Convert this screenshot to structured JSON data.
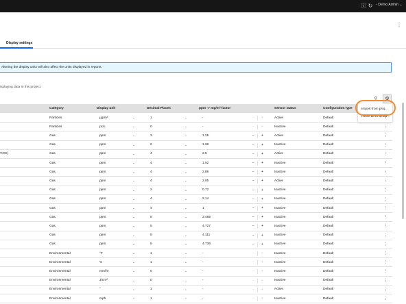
{
  "header": {
    "user_label": "Demo Admin",
    "icons": [
      "info-icon",
      "refresh-icon",
      "user-icon",
      "chevron-down-icon"
    ]
  },
  "tabs": [
    {
      "label": "Display settings",
      "selected": true
    }
  ],
  "info_banner": {
    "text": "Altering the display units will also affect the units displayed in reports."
  },
  "description": "isplaying data in this project.",
  "toolbar_icons": [
    "filter-icon",
    "gear-icon"
  ],
  "menu": {
    "items": [
      "Import from proj...",
      "Reset all to defau..."
    ]
  },
  "accent": "#0f62fe",
  "highlight_color": "#f08b2f",
  "table": {
    "columns": [
      "Category",
      "Display unit",
      "Decimal Places",
      "ppm -> mg/m³ factor",
      "Sensor status",
      "Configuration type"
    ],
    "rows": [
      {
        "name": "",
        "category": "Particles",
        "unit": "µg/m³",
        "places": "1",
        "factor": "-",
        "status": "Active",
        "config": "Default",
        "minus_enabled": false
      },
      {
        "name": "",
        "category": "Particles",
        "unit": "pc/L",
        "places": "0",
        "factor": "-",
        "status": "Inactive",
        "config": "Default",
        "minus_enabled": false
      },
      {
        "name": "",
        "category": "Gas",
        "unit": "ppm",
        "places": "3",
        "factor": "1.25",
        "status": "Active",
        "config": "Default",
        "minus_enabled": true
      },
      {
        "name": "",
        "category": "Gas",
        "unit": "ppm",
        "places": "0",
        "factor": "1.96",
        "status": "Inactive",
        "config": "Default",
        "minus_enabled": true
      },
      {
        "name": "VOC)",
        "category": "Gas",
        "unit": "ppm",
        "places": "4",
        "factor": "2.5",
        "status": "Active",
        "config": "Default",
        "minus_enabled": true
      },
      {
        "name": "",
        "category": "Gas",
        "unit": "ppm",
        "places": "4",
        "factor": "1.52",
        "status": "Inactive",
        "config": "Default",
        "minus_enabled": true
      },
      {
        "name": "",
        "category": "Gas",
        "unit": "ppm",
        "places": "4",
        "factor": "2.86",
        "status": "Inactive",
        "config": "Default",
        "minus_enabled": true
      },
      {
        "name": "",
        "category": "Gas",
        "unit": "ppm",
        "places": "4",
        "factor": "2.05",
        "status": "Active",
        "config": "Default",
        "minus_enabled": true
      },
      {
        "name": "",
        "category": "Gas",
        "unit": "ppm",
        "places": "2",
        "factor": "0.72",
        "status": "Inactive",
        "config": "Default",
        "minus_enabled": true
      },
      {
        "name": "",
        "category": "Gas",
        "unit": "ppm",
        "places": "4",
        "factor": "2.14",
        "status": "Inactive",
        "config": "Default",
        "minus_enabled": true
      },
      {
        "name": "",
        "category": "Gas",
        "unit": "ppm",
        "places": "4",
        "factor": "1",
        "status": "Inactive",
        "config": "Default",
        "minus_enabled": true
      },
      {
        "name": "",
        "category": "Gas",
        "unit": "ppm",
        "places": "5",
        "factor": "3.485",
        "status": "Inactive",
        "config": "Default",
        "minus_enabled": true
      },
      {
        "name": "",
        "category": "Gas",
        "unit": "ppm",
        "places": "5",
        "factor": "4.727",
        "status": "Inactive",
        "config": "Default",
        "minus_enabled": true
      },
      {
        "name": "",
        "category": "Gas",
        "unit": "ppm",
        "places": "5",
        "factor": "4.111",
        "status": "Inactive",
        "config": "Default",
        "minus_enabled": true
      },
      {
        "name": "",
        "category": "Gas",
        "unit": "ppm",
        "places": "5",
        "factor": "4.736",
        "status": "Inactive",
        "config": "Default",
        "minus_enabled": true
      },
      {
        "name": "",
        "category": "Environmental",
        "unit": "°F",
        "places": "1",
        "factor": "-",
        "status": "Inactive",
        "config": "Default",
        "minus_enabled": false
      },
      {
        "name": "",
        "category": "Environmental",
        "unit": "%",
        "places": "1",
        "factor": "-",
        "status": "Inactive",
        "config": "Default",
        "minus_enabled": false
      },
      {
        "name": "",
        "category": "Environmental",
        "unit": "mm/hr",
        "places": "0",
        "factor": "-",
        "status": "Inactive",
        "config": "Default",
        "minus_enabled": false
      },
      {
        "name": "",
        "category": "Environmental",
        "unit": "J/cm²",
        "places": "0",
        "factor": "-",
        "status": "Inactive",
        "config": "Default",
        "minus_enabled": false
      },
      {
        "name": "",
        "category": "Environmental",
        "unit": "°",
        "places": "1",
        "factor": "-",
        "status": "Active",
        "config": "Default",
        "minus_enabled": false
      },
      {
        "name": "",
        "category": "Environmental",
        "unit": "mph",
        "places": "1",
        "factor": "-",
        "status": "Inactive",
        "config": "Default",
        "minus_enabled": false
      }
    ]
  }
}
